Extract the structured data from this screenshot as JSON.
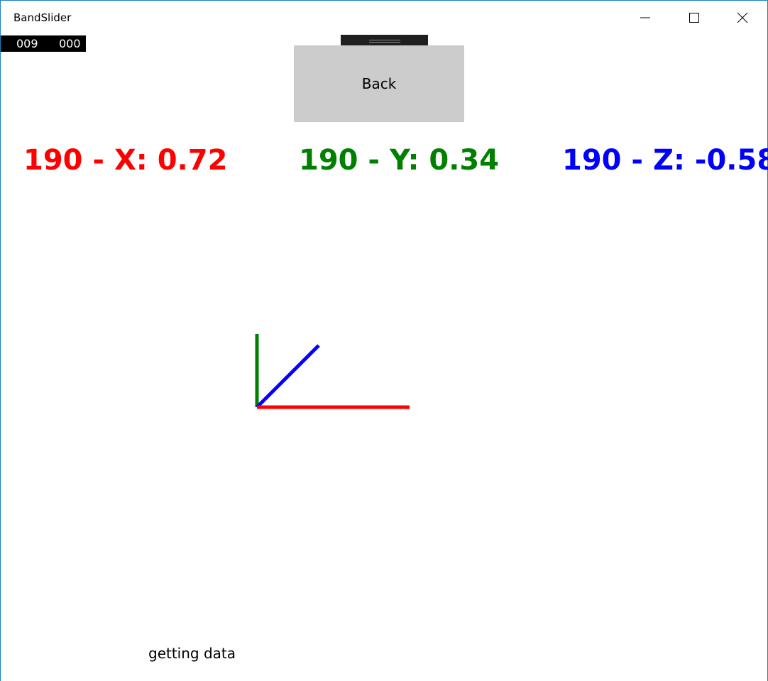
{
  "window": {
    "title": "BandSlider"
  },
  "caption_buttons": {
    "minimize_icon": "minimize-icon",
    "maximize_icon": "maximize-icon",
    "close_icon": "close-icon"
  },
  "counter": {
    "value1": "009",
    "value2": "000"
  },
  "back_button": {
    "label": "Back"
  },
  "readouts": {
    "x": "190 - X: 0.72",
    "y": "190 - Y: 0.34",
    "z": "190 - Z: -0.58"
  },
  "colors": {
    "x_axis": "#ff0000",
    "y_axis": "#008000",
    "z_axis": "#0000ff",
    "button_bg": "#cccccc"
  },
  "status": {
    "text": "getting data"
  }
}
